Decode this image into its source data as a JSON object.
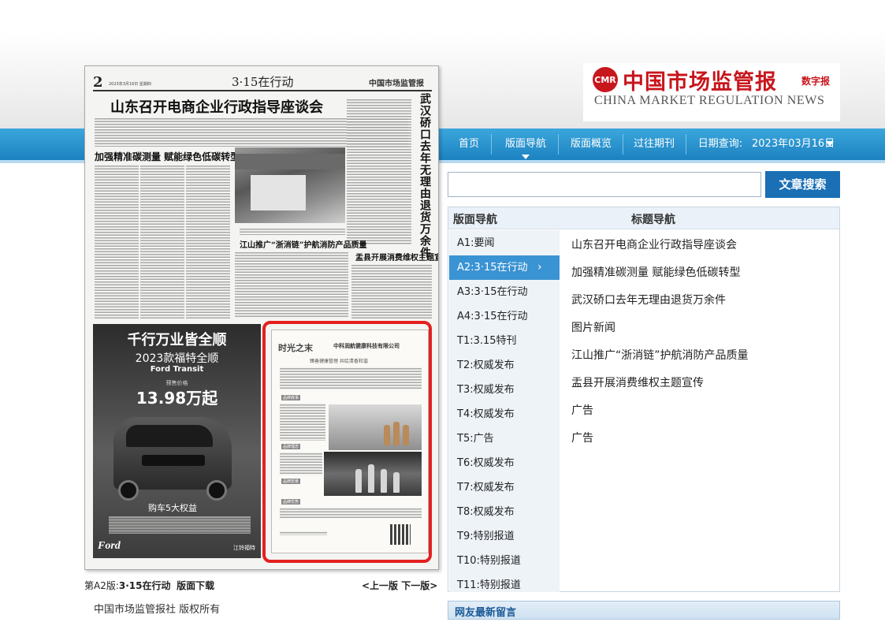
{
  "site": {
    "logo_cn": "中国市场监管报",
    "logo_tag": "数字报",
    "logo_en": "CHINA MARKET REGULATION NEWS"
  },
  "nav": {
    "items": [
      {
        "label": "首页"
      },
      {
        "label": "版面导航"
      },
      {
        "label": "版面概览"
      },
      {
        "label": "过往期刊"
      }
    ],
    "date_label": "日期查询:",
    "date_value": "2023年03月16日"
  },
  "search": {
    "value": "",
    "placeholder": "",
    "button": "文章搜索"
  },
  "panel": {
    "pages_header": "版面导航",
    "titles_header": "标题导航",
    "pages": [
      {
        "label": "A1:要闻"
      },
      {
        "label": "A2:3·15在行动"
      },
      {
        "label": "A3:3·15在行动"
      },
      {
        "label": "A4:3·15在行动"
      },
      {
        "label": "T1:3.15特刊"
      },
      {
        "label": "T2:权威发布"
      },
      {
        "label": "T3:权威发布"
      },
      {
        "label": "T4:权威发布"
      },
      {
        "label": "T5:广告"
      },
      {
        "label": "T6:权威发布"
      },
      {
        "label": "T7:权威发布"
      },
      {
        "label": "T8:权威发布"
      },
      {
        "label": "T9:特别报道"
      },
      {
        "label": "T10:特别报道"
      },
      {
        "label": "T11:特别报道"
      }
    ],
    "active_page_index": 1,
    "titles": [
      {
        "label": "山东召开电商企业行政指导座谈会"
      },
      {
        "label": "加强精准碳测量 赋能绿色低碳转型"
      },
      {
        "label": "武汉硚口去年无理由退货万余件"
      },
      {
        "label": "图片新闻"
      },
      {
        "label": "江山推广“浙消链”护航消防产品质量"
      },
      {
        "label": "盂县开展消费维权主题宣传"
      },
      {
        "label": "广告"
      },
      {
        "label": "广告"
      }
    ]
  },
  "comments": {
    "title": "网友最新留言"
  },
  "newspaper": {
    "page_num": "2",
    "date_line": "2023年3月16日 星期四",
    "section": "3·15在行动",
    "brand": "中国市场监管报",
    "headline": "山东召开电商企业行政指导座谈会",
    "sub_headline": "加强精准碳测量  赋能绿色低碳转型",
    "vertical_headline": "武汉硚口去年无理由退货万余件",
    "headline_2": "江山推广“浙消链”护航消防产品质量",
    "headline_3": "盂县开展消费维权主题宣传",
    "car_ad": {
      "slogan": "千行万业皆全顺",
      "model": "2023款福特全顺",
      "brand": "Ford Transit",
      "price_label": "预售价格",
      "price": "13.98万起",
      "cta": "购车5大权益",
      "logo": "Ford",
      "corner": "江铃福特"
    },
    "health_ad": {
      "logo": "时光之末",
      "company": "中科润航健康科技有限公司",
      "tagline": "臻善健康管理   共绘清香和谐",
      "label_1": "品牌故事",
      "label_2": "品牌理念",
      "label_3": "品牌愿景",
      "label_4": "品牌优势"
    }
  },
  "footer": {
    "page_prefix": "第A2版:",
    "page_name": "3·15在行动",
    "download": "版面下载",
    "prev": "<上一版",
    "next": "下一版>",
    "copyright": "中国市场监管报社 版权所有"
  }
}
